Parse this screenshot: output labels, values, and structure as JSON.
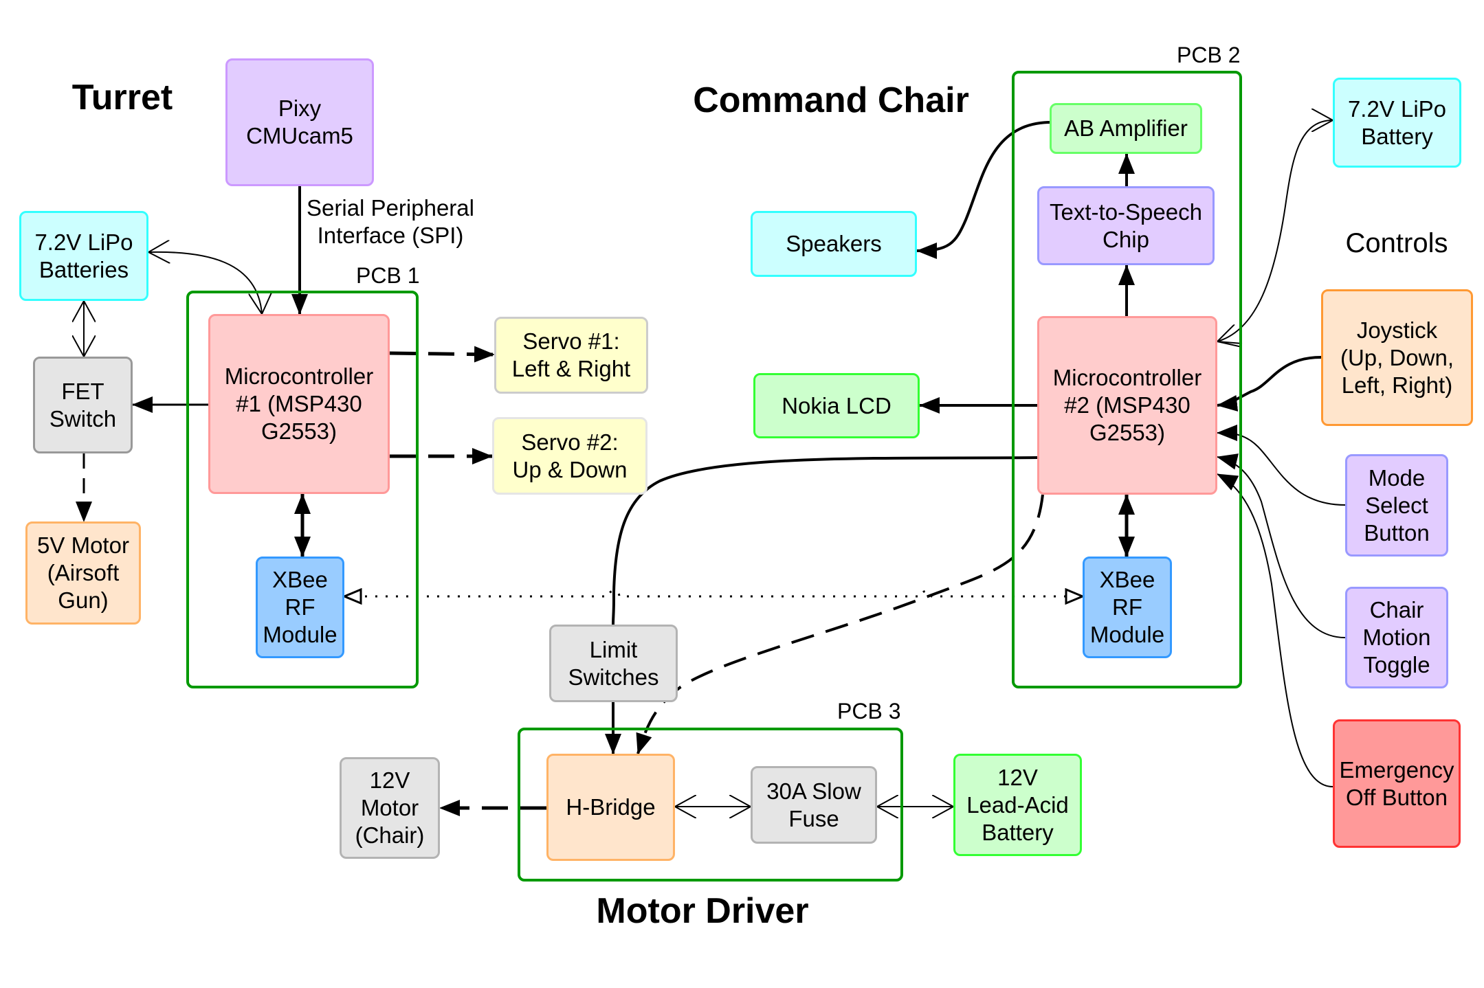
{
  "titles": {
    "turret": "Turret",
    "command_chair": "Command Chair",
    "motor_driver": "Motor Driver",
    "controls": "Controls"
  },
  "pcbs": {
    "pcb1": "PCB 1",
    "pcb2": "PCB 2",
    "pcb3": "PCB 3"
  },
  "edge_labels": {
    "spi": "Serial Peripheral\nInterface (SPI)"
  },
  "blocks": {
    "pixy": "Pixy\nCMUcam5",
    "turret_lipo": "7.2V LiPo\nBatteries",
    "fet_switch": "FET\nSwitch",
    "motor_5v": "5V Motor\n(Airsoft\nGun)",
    "mcu1": "Microcontroller\n#1 (MSP430\nG2553)",
    "xbee1": "XBee\nRF\nModule",
    "servo1": "Servo #1:\nLeft & Right",
    "servo2": "Servo #2:\nUp & Down",
    "ab_amplifier": "AB Amplifier",
    "tts_chip": "Text-to-Speech\nChip",
    "speakers": "Speakers",
    "mcu2": "Microcontroller\n#2 (MSP430\nG2553)",
    "nokia_lcd": "Nokia LCD",
    "xbee2": "XBee\nRF\nModule",
    "chair_lipo": "7.2V LiPo\nBattery",
    "joystick": "Joystick\n(Up, Down,\nLeft, Right)",
    "mode_select": "Mode\nSelect\nButton",
    "chair_motion": "Chair\nMotion\nToggle",
    "emergency_off": "Emergency\nOff Button",
    "limit_switches": "Limit\nSwitches",
    "h_bridge": "H-Bridge",
    "fuse": "30A Slow\nFuse",
    "motor_12v": "12V\nMotor\n(Chair)",
    "lead_acid": "12V\nLead-Acid\nBattery"
  },
  "colors": {
    "pcb_border": "#009900",
    "wire": "#000000"
  }
}
